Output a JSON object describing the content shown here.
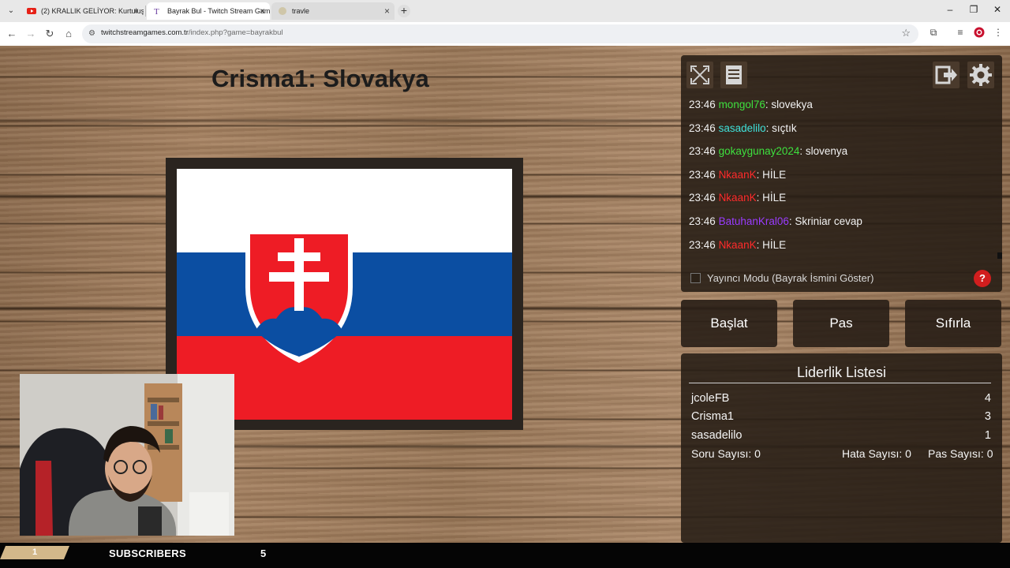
{
  "browser": {
    "tabs": [
      {
        "title": "(2) KRALLIK GELİYOR: Kurtuluş H",
        "icon": "youtube-icon",
        "active": false
      },
      {
        "title": "Bayrak Bul - Twitch Stream Gam",
        "icon": "twitch-stream-games-icon",
        "active": true
      },
      {
        "title": "travle",
        "icon": "globe-icon",
        "active": false
      }
    ],
    "url_host": "twitchstreamgames.com.tr",
    "url_path": "/index.php?game=bayrakbul"
  },
  "game": {
    "title": "Crisma1: Slovakya",
    "flag_name": "Slovakia flag",
    "flag_colors": {
      "white": "#ffffff",
      "blue": "#0b4ea2",
      "red": "#ee1c25"
    }
  },
  "chat": {
    "messages": [
      {
        "time": "23:46",
        "user": "mongol76",
        "text": ": slovekya",
        "color": "#3ee03e"
      },
      {
        "time": "23:46",
        "user": "sasadelilo",
        "text": ": sıçtık",
        "color": "#3fe0d9"
      },
      {
        "time": "23:46",
        "user": "gokaygunay2024",
        "text": ": slovenya",
        "color": "#3ee03e"
      },
      {
        "time": "23:46",
        "user": "NkaanK",
        "text": ": HİLE",
        "color": "#ff2b2b"
      },
      {
        "time": "23:46",
        "user": "NkaanK",
        "text": ": HİLE",
        "color": "#ff2b2b"
      },
      {
        "time": "23:46",
        "user": "BatuhanKral06",
        "text": ": Skriniar cevap",
        "color": "#9b3cff"
      },
      {
        "time": "23:46",
        "user": "NkaanK",
        "text": ": HİLE",
        "color": "#ff2b2b"
      }
    ],
    "streamer_mode_label": "Yayıncı Modu (Bayrak İsmini Göster)",
    "streamer_mode_checked": false,
    "help_label": "?"
  },
  "actions": {
    "start": "Başlat",
    "pass": "Pas",
    "reset": "Sıfırla"
  },
  "leaderboard": {
    "title": "Liderlik Listesi",
    "rows": [
      {
        "name": "jcoleFB",
        "score": "4"
      },
      {
        "name": "Crisma1",
        "score": "3"
      },
      {
        "name": "sasadelilo",
        "score": "1"
      }
    ],
    "stats": {
      "questions": "Soru Sayısı: 0",
      "errors": "Hata Sayısı: 0",
      "passes": "Pas Sayısı: 0"
    }
  },
  "stream_bar": {
    "badge": "1",
    "label": "SUBSCRIBERS",
    "count": "5"
  }
}
